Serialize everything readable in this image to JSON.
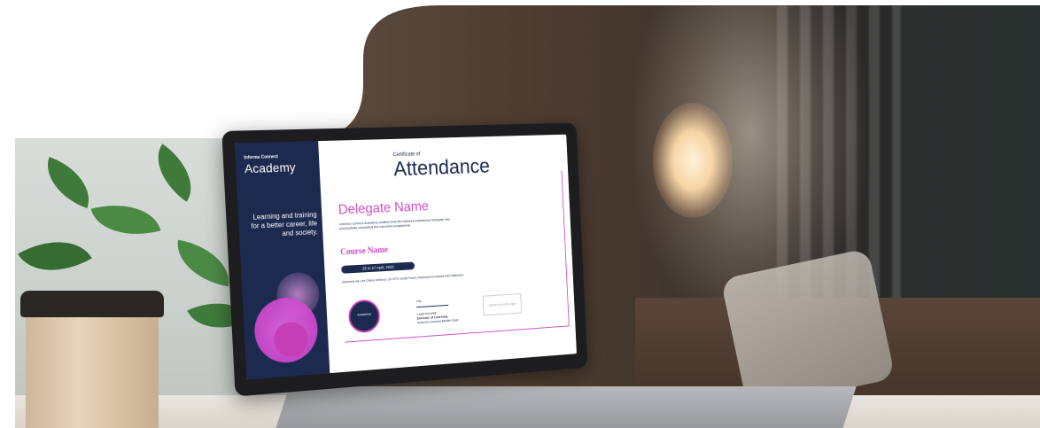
{
  "certificate": {
    "brand_small": "Informa Connect",
    "brand_big": "Academy",
    "tagline": "Learning and training for a better career, life and society.",
    "certificate_of": "Certificate of",
    "title": "Attendance",
    "delegate": "Delegate Name",
    "statement": "Informa Connect Academy certifies that the named professional Delegate has successfully completed the executive programme",
    "course": "Course Name",
    "date": "25 to 27 April, 2025",
    "delivered": "Delivered via Live Online Delivery  |  30 CPD Credit Points  |  Assessment Passed with Distinction",
    "badge_label": "Academy",
    "signer_name": "Leigh Kendall",
    "signer_title": "Director of Learning",
    "signer_org": "Informa Connect Middle East",
    "logo_placeholder": "Space for extra Logo"
  },
  "colors": {
    "navy": "#1b2a4e",
    "magenta": "#d14bc7"
  }
}
